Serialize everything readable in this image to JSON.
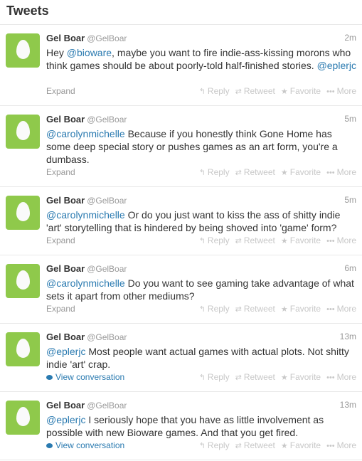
{
  "header": {
    "title": "Tweets"
  },
  "actions": {
    "reply": "Reply",
    "retweet": "Retweet",
    "favorite": "Favorite",
    "more": "More",
    "expand": "Expand",
    "view_conversation": "View conversation"
  },
  "icons": {
    "reply": "reply-arrow-icon",
    "retweet": "retweet-icon",
    "favorite": "star-icon",
    "more": "ellipsis-icon",
    "conversation": "speech-bubble-icon"
  },
  "colors": {
    "link": "#2a7ab0",
    "avatar_bg": "#8fc94b"
  },
  "tweets": [
    {
      "name": "Gel Boar",
      "handle": "@GelBoar",
      "time": "2m",
      "parts": [
        {
          "t": "Hey "
        },
        {
          "t": "@bioware",
          "link": true
        },
        {
          "t": ", maybe you want to fire indie-ass-kissing morons who think games should be about poorly-told half-finished stories. "
        },
        {
          "t": "@eplerjc",
          "link": true
        }
      ],
      "footer": "expand"
    },
    {
      "name": "Gel Boar",
      "handle": "@GelBoar",
      "time": "5m",
      "parts": [
        {
          "t": "@carolynmichelle",
          "link": true
        },
        {
          "t": " Because if you honestly think Gone Home has some deep special story or pushes games as an art form, you're a dumbass."
        }
      ],
      "footer": "expand"
    },
    {
      "name": "Gel Boar",
      "handle": "@GelBoar",
      "time": "5m",
      "parts": [
        {
          "t": "@carolynmichelle",
          "link": true
        },
        {
          "t": " Or do you just want to kiss the ass of shitty indie 'art' storytelling that is hindered by being shoved into 'game' form?"
        }
      ],
      "footer": "expand"
    },
    {
      "name": "Gel Boar",
      "handle": "@GelBoar",
      "time": "6m",
      "parts": [
        {
          "t": "@carolynmichelle",
          "link": true
        },
        {
          "t": " Do you want to see gaming take advantage of what sets it apart from other mediums?"
        }
      ],
      "footer": "expand"
    },
    {
      "name": "Gel Boar",
      "handle": "@GelBoar",
      "time": "13m",
      "parts": [
        {
          "t": "@eplerjc",
          "link": true
        },
        {
          "t": " Most people want actual games with actual plots. Not shitty indie 'art' crap."
        }
      ],
      "footer": "conversation"
    },
    {
      "name": "Gel Boar",
      "handle": "@GelBoar",
      "time": "13m",
      "parts": [
        {
          "t": "@eplerjc",
          "link": true
        },
        {
          "t": " I seriously hope that you have as little involvement as possible with new Bioware games. And that you get fired."
        }
      ],
      "footer": "conversation"
    }
  ]
}
